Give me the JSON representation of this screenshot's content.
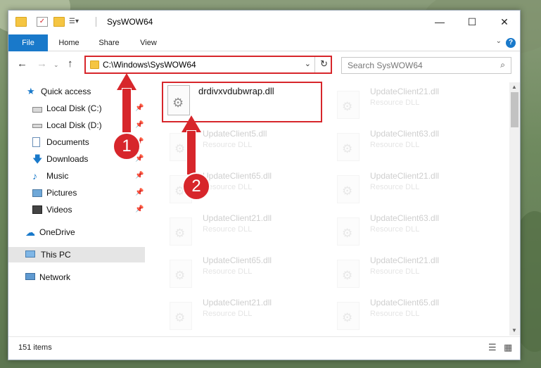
{
  "window": {
    "title": "SysWOW64"
  },
  "ribbon": {
    "tabs": [
      "File",
      "Home",
      "Share",
      "View"
    ]
  },
  "address": {
    "path": "C:\\Windows\\SysWOW64"
  },
  "search": {
    "placeholder": "Search SysWOW64"
  },
  "nav": {
    "quick_access": "Quick access",
    "items": [
      "Local Disk (C:)",
      "Local Disk (D:)",
      "Documents",
      "Downloads",
      "Music",
      "Pictures",
      "Videos"
    ],
    "onedrive": "OneDrive",
    "this_pc": "This PC",
    "network": "Network"
  },
  "files": {
    "highlighted": {
      "name": "drdivxvdubwrap.dll"
    },
    "left_column": [
      {
        "name": "UpdateClient5.dll",
        "type": "Resource DLL"
      },
      {
        "name": "UpdateClient65.dll",
        "type": "Resource DLL"
      },
      {
        "name": "UpdateClient21.dll",
        "type": "Resource DLL"
      },
      {
        "name": "UpdateClient65.dll",
        "type": "Resource DLL"
      },
      {
        "name": "UpdateClient21.dll",
        "type": "Resource DLL"
      }
    ],
    "right_column": [
      {
        "name": "UpdateClient21.dll",
        "type": "Resource DLL"
      },
      {
        "name": "UpdateClient63.dll",
        "type": "Resource DLL"
      },
      {
        "name": "UpdateClient21.dll",
        "type": "Resource DLL"
      },
      {
        "name": "UpdateClient63.dll",
        "type": "Resource DLL"
      },
      {
        "name": "UpdateClient21.dll",
        "type": "Resource DLL"
      },
      {
        "name": "UpdateClient65.dll",
        "type": "Resource DLL"
      }
    ]
  },
  "status": {
    "count": "151 items"
  },
  "markers": {
    "one": "1",
    "two": "2"
  },
  "colors": {
    "accent": "#1979ca",
    "highlight": "#d7262b"
  }
}
